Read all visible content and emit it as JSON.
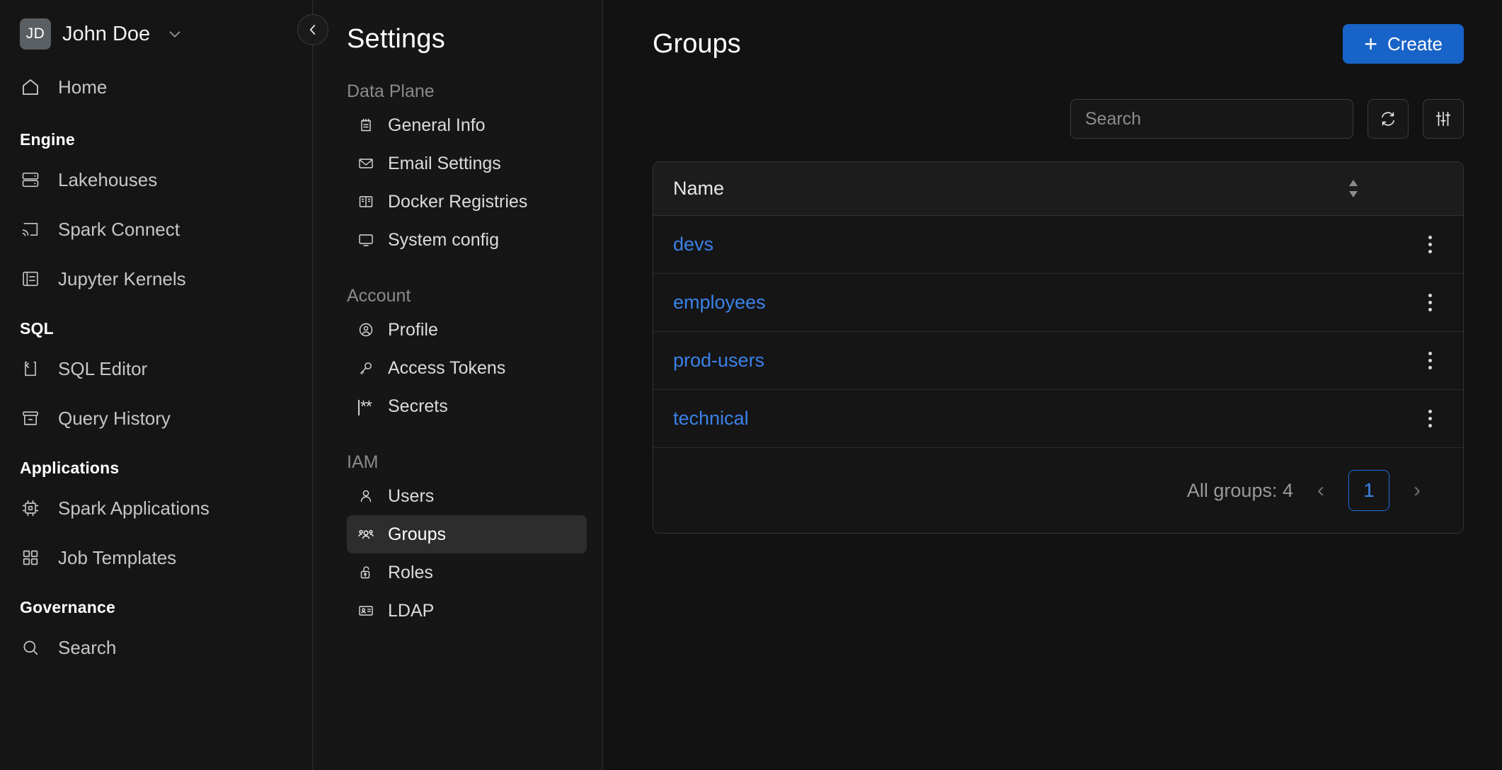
{
  "leftnav": {
    "user": {
      "initials": "JD",
      "name": "John Doe",
      "chevron_icon": "chevron-down-icon"
    },
    "home": {
      "label": "Home",
      "icon": "home-icon"
    },
    "sections": [
      {
        "title": "Engine",
        "items": [
          {
            "label": "Lakehouses",
            "icon": "database-icon"
          },
          {
            "label": "Spark Connect",
            "icon": "cast-icon"
          },
          {
            "label": "Jupyter Kernels",
            "icon": "notebook-icon"
          }
        ]
      },
      {
        "title": "SQL",
        "items": [
          {
            "label": "SQL Editor",
            "icon": "code-file-icon"
          },
          {
            "label": "Query History",
            "icon": "archive-icon"
          }
        ]
      },
      {
        "title": "Applications",
        "items": [
          {
            "label": "Spark Applications",
            "icon": "chip-icon"
          },
          {
            "label": "Job Templates",
            "icon": "grid-icon"
          }
        ]
      },
      {
        "title": "Governance",
        "items": [
          {
            "label": "Search",
            "icon": "search-icon"
          }
        ]
      }
    ],
    "collapse_button": {
      "icon": "chevron-left-icon"
    }
  },
  "settings": {
    "title": "Settings",
    "groups": [
      {
        "title": "Data Plane",
        "items": [
          {
            "label": "General Info",
            "icon": "notepad-icon",
            "active": false
          },
          {
            "label": "Email Settings",
            "icon": "envelope-icon",
            "active": false
          },
          {
            "label": "Docker Registries",
            "icon": "registry-icon",
            "active": false
          },
          {
            "label": "System config",
            "icon": "monitor-icon",
            "active": false
          }
        ]
      },
      {
        "title": "Account",
        "items": [
          {
            "label": "Profile",
            "icon": "user-circle-icon",
            "active": false
          },
          {
            "label": "Access Tokens",
            "icon": "key-icon",
            "active": false
          },
          {
            "label": "Secrets",
            "icon": "password-icon",
            "active": false
          }
        ]
      },
      {
        "title": "IAM",
        "items": [
          {
            "label": "Users",
            "icon": "user-icon",
            "active": false
          },
          {
            "label": "Groups",
            "icon": "users-icon",
            "active": true
          },
          {
            "label": "Roles",
            "icon": "unlock-icon",
            "active": false
          },
          {
            "label": "LDAP",
            "icon": "id-card-icon",
            "active": false
          }
        ]
      }
    ]
  },
  "main": {
    "page_title": "Groups",
    "create_button": {
      "label": "Create",
      "icon": "plus-icon"
    },
    "search": {
      "value": "",
      "placeholder": "Search",
      "icon": "search-icon"
    },
    "refresh_button": {
      "icon": "refresh-icon"
    },
    "filter_button": {
      "icon": "sliders-icon"
    },
    "table": {
      "columns": [
        {
          "label": "Name",
          "sort_icon": "sort-icon"
        }
      ],
      "rows": [
        {
          "name": "devs",
          "menu_icon": "kebab-menu-icon"
        },
        {
          "name": "employees",
          "menu_icon": "kebab-menu-icon"
        },
        {
          "name": "prod-users",
          "menu_icon": "kebab-menu-icon"
        },
        {
          "name": "technical",
          "menu_icon": "kebab-menu-icon"
        }
      ],
      "footer": {
        "count_label": "All groups: 4",
        "prev_label": "‹",
        "page_number": "1",
        "next_label": "›"
      }
    }
  },
  "colors": {
    "accent_blue": "#1863c7",
    "link_blue": "#3b82e8",
    "background": "#121212",
    "panel": "#161616",
    "active_item": "#2d2d2d"
  }
}
